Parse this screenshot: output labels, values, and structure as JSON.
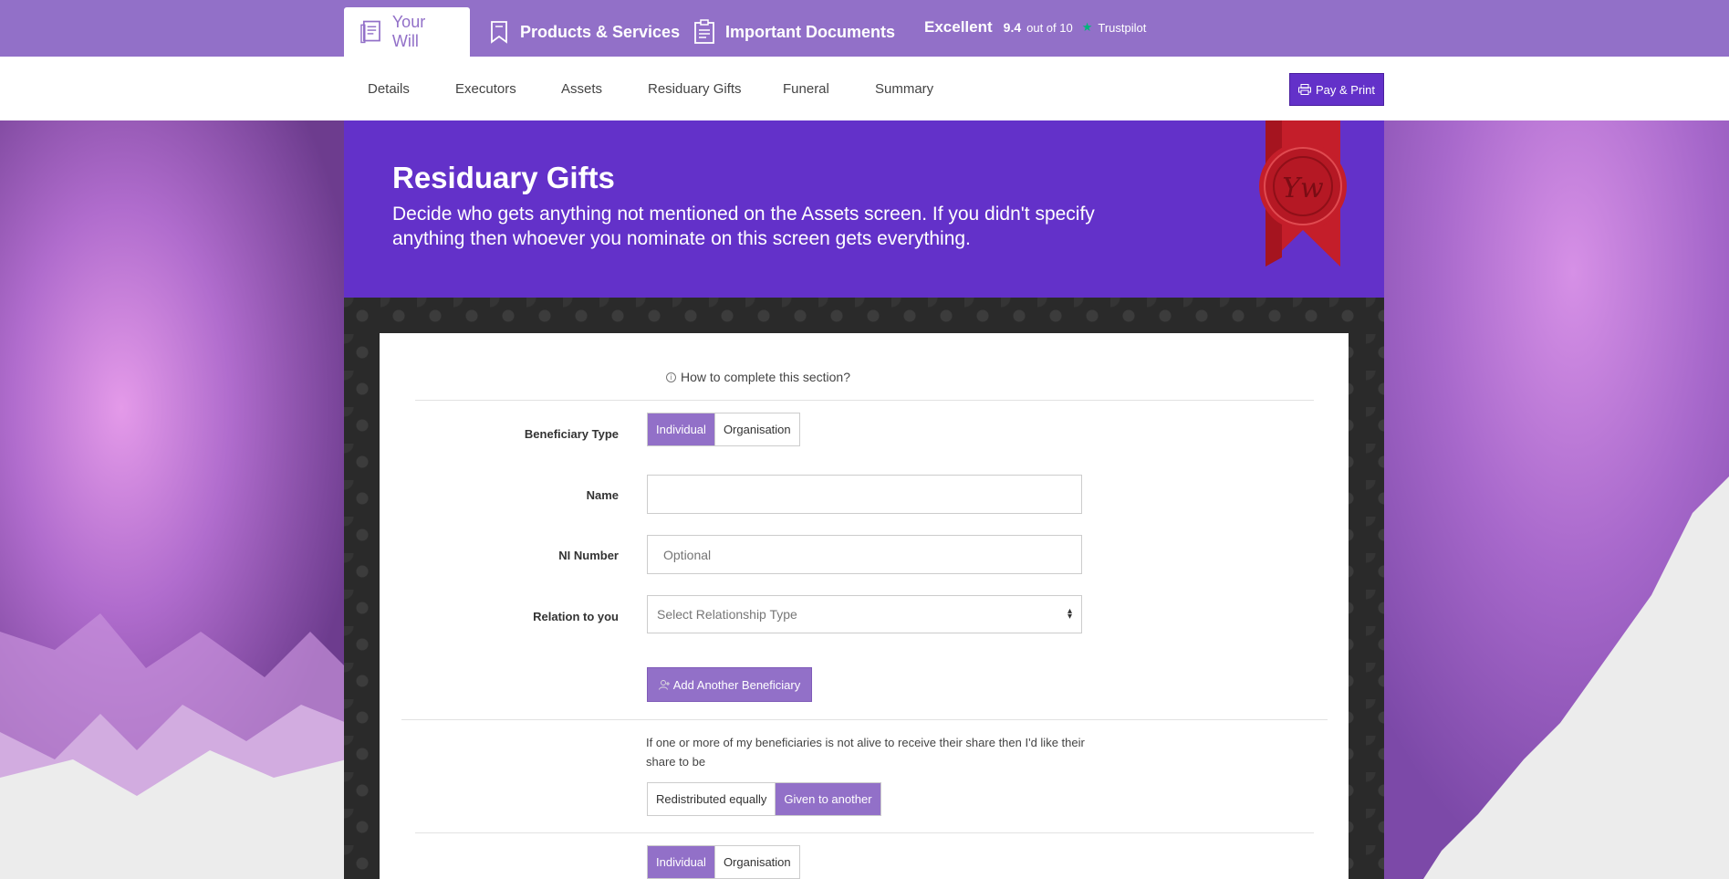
{
  "top_tabs": [
    {
      "label": "Your Will",
      "icon": "document-icon",
      "active": true
    },
    {
      "label": "Products & Services",
      "icon": "bookmark-icon",
      "active": false
    },
    {
      "label": "Important Documents",
      "icon": "clipboard-icon",
      "active": false
    }
  ],
  "rating": {
    "label": "Excellent",
    "score": "9.4",
    "out_of": "out of 10",
    "brand": "Trustpilot",
    "brand_icon": "star-icon",
    "brand_color": "#00b67a"
  },
  "nav": {
    "items": [
      "Details",
      "Executors",
      "Assets",
      "Residuary Gifts",
      "Funeral",
      "Summary"
    ],
    "pay_button": "Pay & Print",
    "pay_icon": "printer-icon"
  },
  "banner": {
    "title": "Residuary Gifts",
    "description": "Decide who gets anything not mentioned on the Assets screen. If you didn't specify anything then whoever you nominate on this screen gets everything.",
    "seal_text": "Yw"
  },
  "form": {
    "help_link": "How to complete this section?",
    "beneficiary_type": {
      "label": "Beneficiary Type",
      "options": [
        "Individual",
        "Organisation"
      ],
      "selected": "Individual"
    },
    "name": {
      "label": "Name",
      "value": "",
      "placeholder": ""
    },
    "ni_number": {
      "label": "NI Number",
      "value": "",
      "placeholder": "Optional"
    },
    "relation": {
      "label": "Relation to you",
      "selected": "Select Relationship Type"
    },
    "add_button": "Add Another Beneficiary",
    "survivorship_note": "If one or more of my beneficiaries is not alive to receive their share then I'd like their share to be",
    "share_options": [
      "Redistributed equally",
      "Given to another"
    ],
    "share_selected": "Given to another",
    "beneficiary_type_2": {
      "options": [
        "Individual",
        "Organisation"
      ],
      "selected": "Individual"
    }
  },
  "colors": {
    "topbar": "#9270c8",
    "accent": "#6331c9",
    "segment_active": "#9270c8"
  }
}
